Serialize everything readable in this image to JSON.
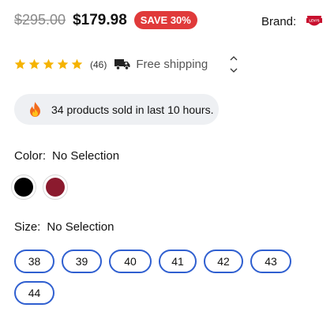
{
  "price": {
    "old": "$295.00",
    "current": "$179.98",
    "badge": "SAVE 30%",
    "badge_color": "#e03a3a"
  },
  "brand": {
    "label": "Brand:",
    "logo_icon": "levis-logo",
    "logo_text": "LEVI'S"
  },
  "rating": {
    "stars": 5,
    "star_color": "#f5b301",
    "count": "(46)"
  },
  "shipping": {
    "icon": "truck-icon",
    "text": "Free shipping"
  },
  "sold_notice": {
    "icon": "fire-icon",
    "text": "34 products sold in last 10 hours."
  },
  "color": {
    "label": "Color:",
    "value": "No Selection",
    "options": [
      {
        "name": "black",
        "hex": "#000000"
      },
      {
        "name": "maroon",
        "hex": "#8b1a2e"
      }
    ]
  },
  "size": {
    "label": "Size:",
    "value": "No Selection",
    "options": [
      "38",
      "39",
      "40",
      "41",
      "42",
      "43",
      "44"
    ],
    "border_color": "#2f5fd0"
  }
}
